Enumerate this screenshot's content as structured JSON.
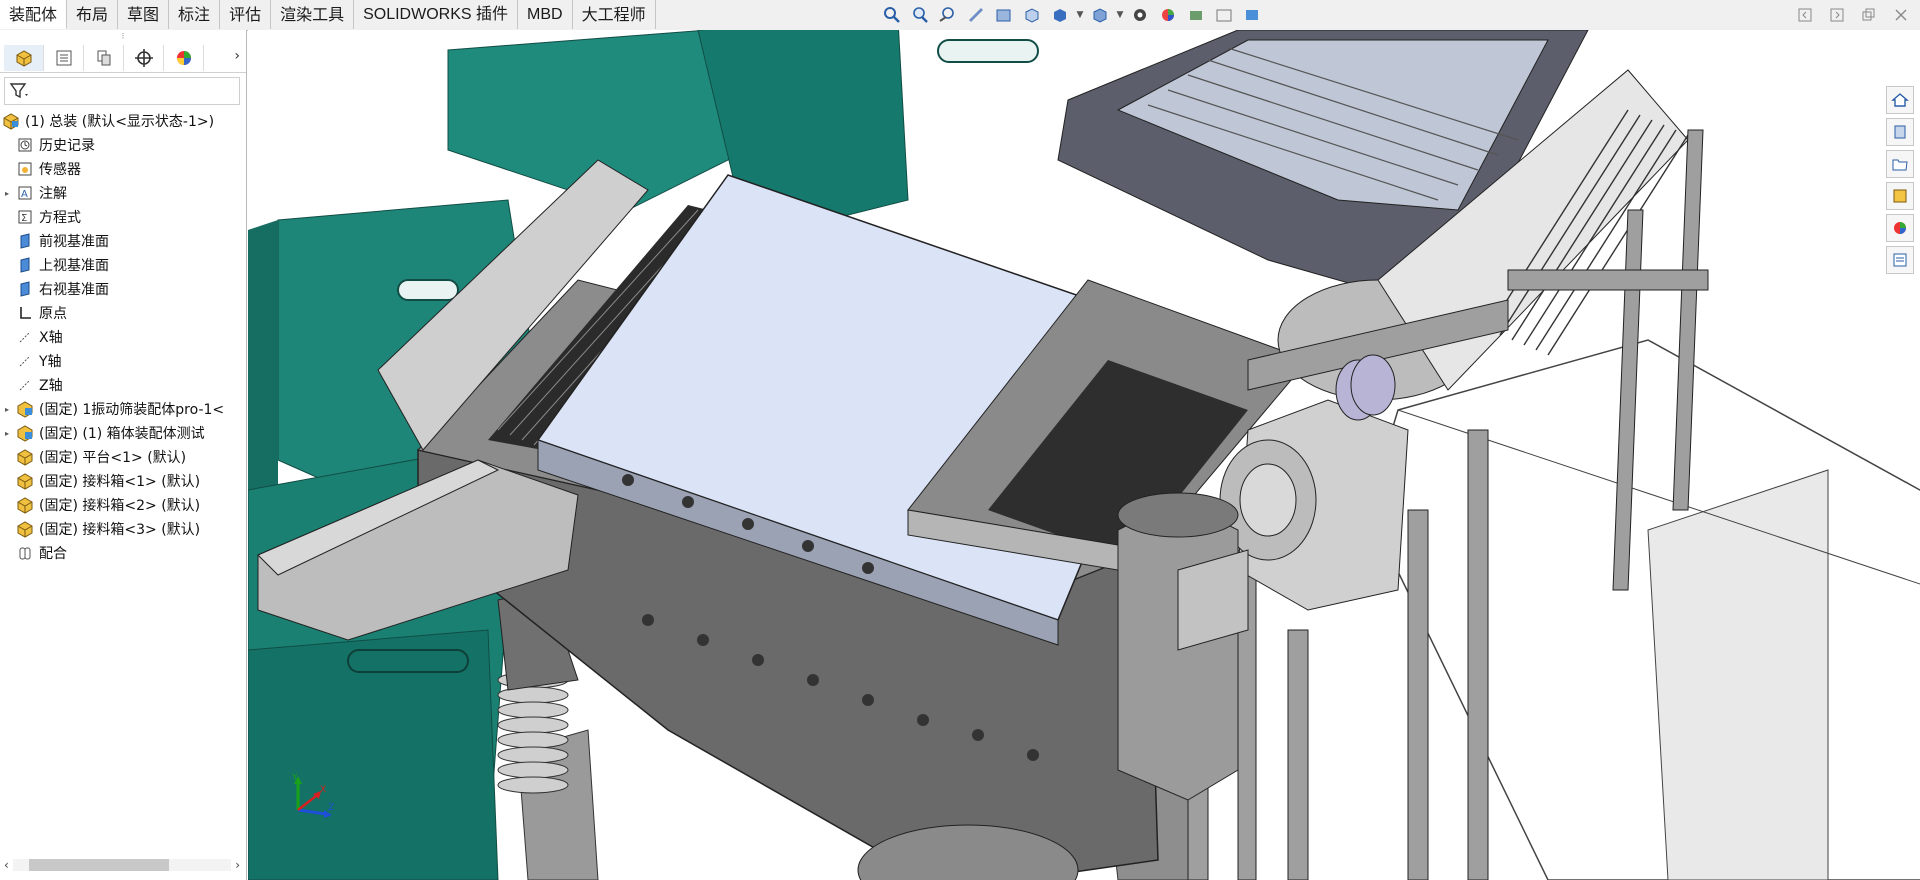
{
  "tabs": [
    {
      "label": "装配体",
      "active": true
    },
    {
      "label": "布局"
    },
    {
      "label": "草图"
    },
    {
      "label": "标注"
    },
    {
      "label": "评估"
    },
    {
      "label": "渲染工具"
    },
    {
      "label": "SOLIDWORKS 插件"
    },
    {
      "label": "MBD"
    },
    {
      "label": "大工程师"
    }
  ],
  "headsup_icons": [
    "zoom-to-fit-icon",
    "zoom-area-icon",
    "previous-view-icon",
    "section-view-icon",
    "dynamic-annotation-icon",
    "view-orientation-icon",
    "display-style-icon",
    "hide-show-icon",
    "edit-appearance-icon",
    "apply-scene-icon",
    "view-settings-icon",
    "display-pane-icon"
  ],
  "window_controls": [
    "collapse-icon",
    "expand-icon",
    "restore-icon",
    "close-icon"
  ],
  "tree": {
    "root": "(1) 总装 (默认<显示状态-1>)",
    "items": [
      {
        "label": "历史记录",
        "icon": "history-icon",
        "expandable": false
      },
      {
        "label": "传感器",
        "icon": "sensor-icon",
        "expandable": false
      },
      {
        "label": "注解",
        "icon": "annotation-icon",
        "expandable": true
      },
      {
        "label": "方程式",
        "icon": "equation-icon",
        "expandable": false
      },
      {
        "label": "前视基准面",
        "icon": "plane-icon",
        "expandable": false
      },
      {
        "label": "上视基准面",
        "icon": "plane-icon",
        "expandable": false
      },
      {
        "label": "右视基准面",
        "icon": "plane-icon",
        "expandable": false
      },
      {
        "label": "原点",
        "icon": "origin-icon",
        "expandable": false
      },
      {
        "label": "X轴",
        "icon": "axis-icon",
        "expandable": false
      },
      {
        "label": "Y轴",
        "icon": "axis-icon",
        "expandable": false
      },
      {
        "label": "Z轴",
        "icon": "axis-icon",
        "expandable": false
      },
      {
        "label": "(固定) 1振动筛装配体pro-1<",
        "icon": "subassembly-icon",
        "expandable": true
      },
      {
        "label": "(固定) (1) 箱体装配体测试",
        "icon": "subassembly-icon",
        "expandable": true
      },
      {
        "label": "(固定) 平台<1> (默认)",
        "icon": "part-icon",
        "expandable": false
      },
      {
        "label": "(固定) 接料箱<1> (默认)",
        "icon": "part-icon",
        "expandable": false
      },
      {
        "label": "(固定) 接料箱<2> (默认)",
        "icon": "part-icon",
        "expandable": false
      },
      {
        "label": "(固定) 接料箱<3> (默认)",
        "icon": "part-icon",
        "expandable": false
      },
      {
        "label": "配合",
        "icon": "mates-icon",
        "expandable": false
      }
    ]
  },
  "right_toolbar": [
    "home-icon",
    "design-library-icon",
    "file-explorer-icon",
    "view-palette-icon",
    "appearances-icon",
    "custom-properties-icon"
  ],
  "triad": {
    "x": "X",
    "y": "Y",
    "z": "Z"
  }
}
